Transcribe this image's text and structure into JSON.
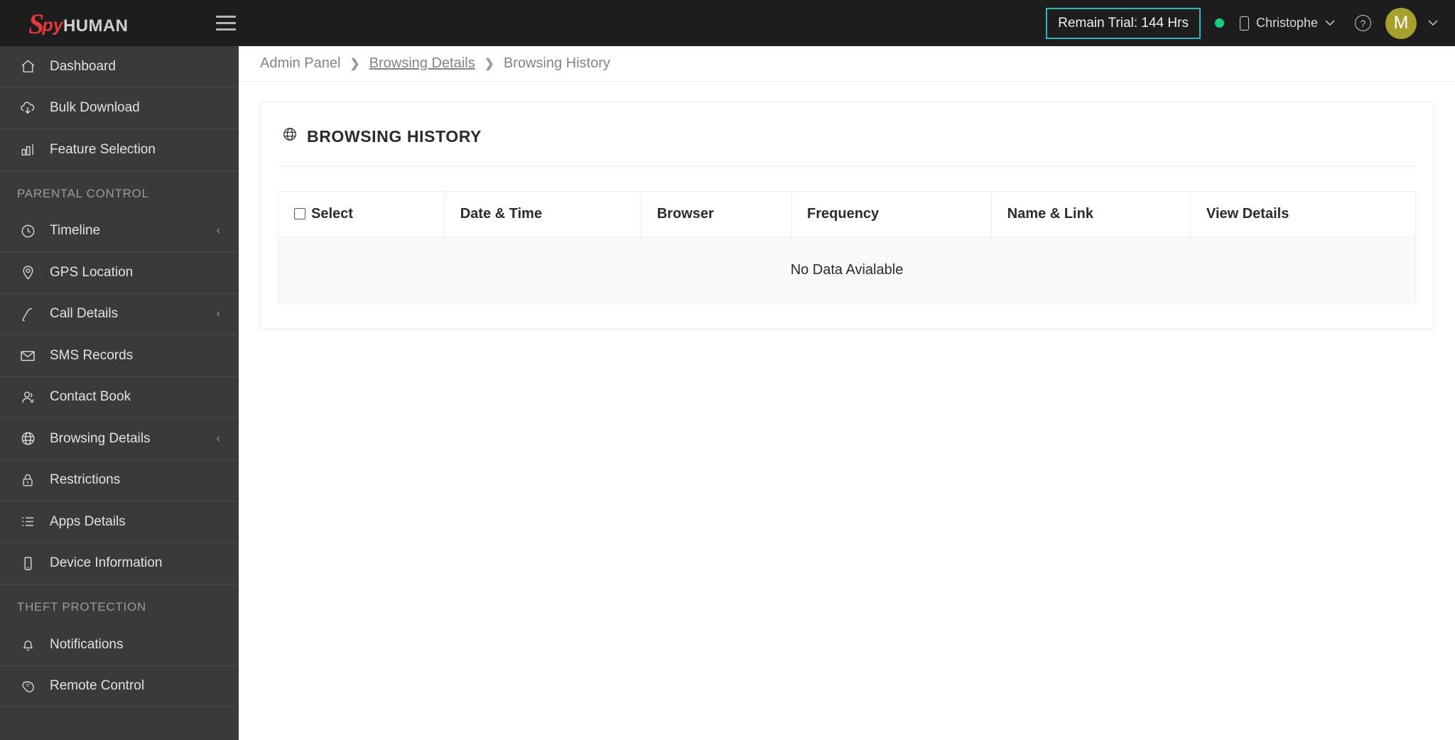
{
  "brand": {
    "prefix": "S",
    "mid": "py",
    "suffix": "HUMAN"
  },
  "topbar": {
    "menu_icon": "hamburger-icon",
    "trial_label": "Remain Trial: 144 Hrs",
    "trial_border_color": "#2fb5c4",
    "status_color": "#18cf7a",
    "device_name": "Christophe",
    "device_icon": "phone-icon",
    "help_icon": "help-circle-icon",
    "avatar_initial": "M",
    "avatar_color": "#a8a02e",
    "chevron": "⌄"
  },
  "sidebar": {
    "items": [
      {
        "label": "Dashboard",
        "icon": "home-icon",
        "arrow": ""
      },
      {
        "label": "Bulk Download",
        "icon": "cloud-download-icon",
        "arrow": ""
      },
      {
        "label": "Feature Selection",
        "icon": "bar-chart-icon",
        "arrow": ""
      }
    ],
    "section_parental": "PARENTAL CONTROL",
    "parental_items": [
      {
        "label": "Timeline",
        "icon": "clock-icon",
        "arrow": "‹"
      },
      {
        "label": "GPS Location",
        "icon": "map-pin-icon",
        "arrow": ""
      },
      {
        "label": "Call Details",
        "icon": "phone-call-icon",
        "arrow": "‹"
      },
      {
        "label": "SMS Records",
        "icon": "envelope-icon",
        "arrow": ""
      },
      {
        "label": "Contact Book",
        "icon": "contacts-icon",
        "arrow": ""
      },
      {
        "label": "Browsing Details",
        "icon": "globe-icon",
        "arrow": "‹"
      },
      {
        "label": "Restrictions",
        "icon": "lock-icon",
        "arrow": ""
      },
      {
        "label": "Apps Details",
        "icon": "list-icon",
        "arrow": ""
      },
      {
        "label": "Device Information",
        "icon": "device-icon",
        "arrow": ""
      }
    ],
    "section_theft": "THEFT PROTECTION",
    "theft_items": [
      {
        "label": "Notifications",
        "icon": "bell-icon",
        "arrow": ""
      },
      {
        "label": "Remote Control",
        "icon": "gamepad-icon",
        "arrow": ""
      }
    ]
  },
  "breadcrumb": {
    "root": "Admin Panel",
    "separator": "❯",
    "parent": "Browsing Details",
    "current": "Browsing History"
  },
  "card": {
    "icon": "globe-icon",
    "title": "BROWSING HISTORY",
    "table": {
      "columns": [
        "Select",
        "Date & Time",
        "Browser",
        "Frequency",
        "Name & Link",
        "View Details"
      ],
      "select_checkbox": "select-all-checkbox",
      "rows": [],
      "empty_message": "No Data Avialable"
    }
  }
}
